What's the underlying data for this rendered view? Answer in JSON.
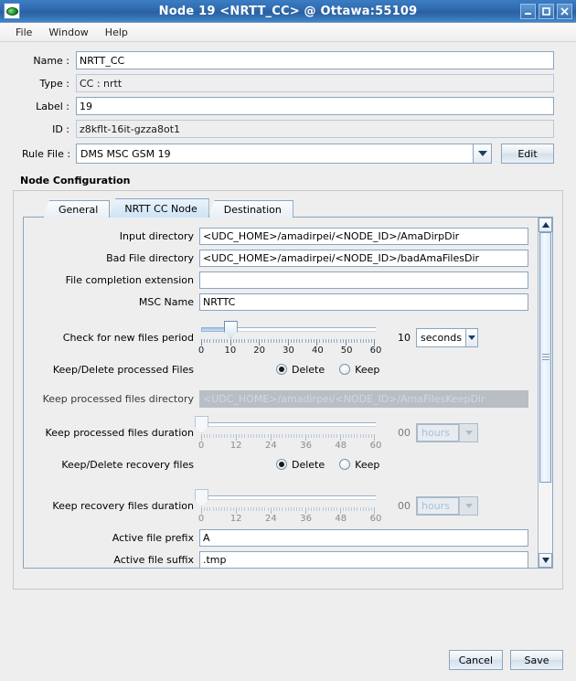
{
  "window": {
    "title": "Node 19 <NRTT_CC> @ Ottawa:55109",
    "app_icon": "green-oval-icon",
    "buttons": {
      "minimize": "minimize-icon",
      "maximize": "maximize-icon",
      "close": "close-icon"
    }
  },
  "menubar": {
    "items": [
      {
        "label": "File"
      },
      {
        "label": "Window"
      },
      {
        "label": "Help"
      }
    ]
  },
  "form": {
    "name": {
      "label": "Name :",
      "value": "NRTT_CC"
    },
    "type": {
      "label": "Type :",
      "value": "CC : nrtt"
    },
    "label_field": {
      "label": "Label :",
      "value": "19"
    },
    "id": {
      "label": "ID :",
      "value": "z8kflt-16it-gzza8ot1"
    },
    "rule_file": {
      "label": "Rule File :",
      "value": "DMS MSC GSM 19"
    },
    "edit_button": "Edit"
  },
  "node_configuration": {
    "title": "Node  Configuration",
    "tabs": [
      {
        "label": "General",
        "active": false
      },
      {
        "label": "NRTT CC Node",
        "active": true
      },
      {
        "label": "Destination",
        "active": false
      }
    ],
    "fields": {
      "input_directory": {
        "label": "Input directory",
        "value": "<UDC_HOME>/amadirpei/<NODE_ID>/AmaDirpDir"
      },
      "bad_file_directory": {
        "label": "Bad File directory",
        "value": "<UDC_HOME>/amadirpei/<NODE_ID>/badAmaFilesDir"
      },
      "file_completion_extension": {
        "label": "File completion extension",
        "value": ""
      },
      "msc_name": {
        "label": "MSC Name",
        "value": "NRTTC"
      },
      "check_period": {
        "label": "Check for new files period",
        "value": "10",
        "unit": "seconds",
        "slider": {
          "min": 0,
          "max": 60,
          "value": 10,
          "ticks": [
            0,
            10,
            20,
            30,
            40,
            50,
            60
          ]
        }
      },
      "keep_delete_processed": {
        "label": "Keep/Delete processed Files",
        "options": [
          {
            "label": "Delete",
            "selected": true
          },
          {
            "label": "Keep",
            "selected": false
          }
        ]
      },
      "keep_processed_directory": {
        "label": "Keep processed files directory",
        "value": "<UDC_HOME>/amadirpei/<NODE_ID>/AmaFilesKeepDir",
        "disabled": true
      },
      "keep_processed_duration": {
        "label": "Keep processed files duration",
        "value": "00",
        "unit": "hours",
        "disabled": true,
        "slider": {
          "min": 0,
          "max": 60,
          "value": 0,
          "ticks": [
            0,
            12,
            24,
            36,
            48,
            60
          ]
        }
      },
      "keep_delete_recovery": {
        "label": "Keep/Delete recovery files",
        "options": [
          {
            "label": "Delete",
            "selected": true
          },
          {
            "label": "Keep",
            "selected": false
          }
        ]
      },
      "keep_recovery_duration": {
        "label": "Keep recovery files duration",
        "value": "00",
        "unit": "hours",
        "disabled": true,
        "slider": {
          "min": 0,
          "max": 60,
          "value": 0,
          "ticks": [
            0,
            12,
            24,
            36,
            48,
            60
          ]
        }
      },
      "active_file_prefix": {
        "label": "Active file prefix",
        "value": "A"
      },
      "active_file_suffix": {
        "label": "Active file suffix",
        "value": ".tmp"
      }
    }
  },
  "footer": {
    "cancel": "Cancel",
    "save": "Save"
  },
  "colors": {
    "titlebar": "#2f69ad",
    "accent": "#8aa5c0",
    "background": "#eeeeee",
    "tab_active": "#cde3f5"
  }
}
